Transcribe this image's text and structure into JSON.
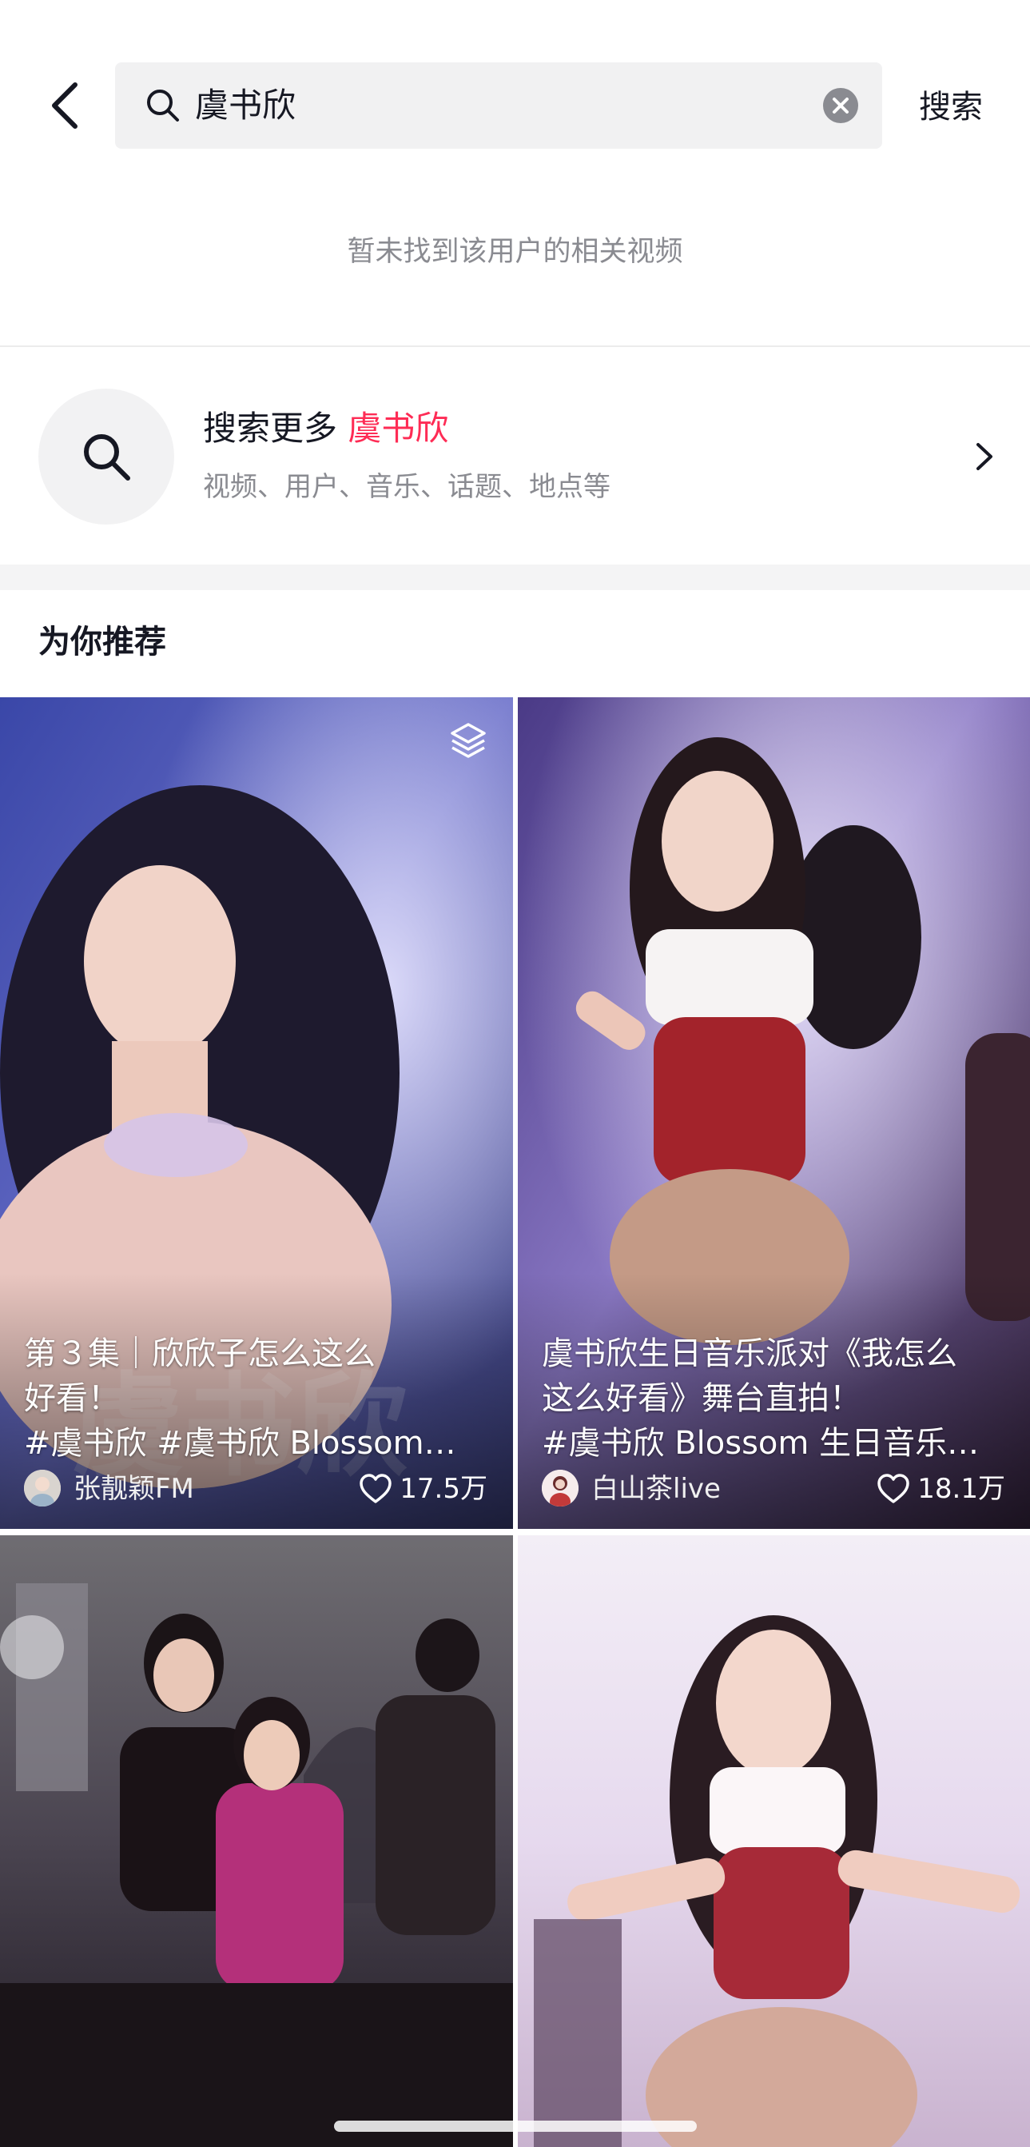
{
  "search": {
    "query": "虞书欣",
    "action_label": "搜索"
  },
  "empty_message": "暂未找到该用户的相关视频",
  "search_more": {
    "prefix": "搜索更多",
    "keyword": "虞书欣",
    "subtitle": "视频、用户、音乐、话题、地点等"
  },
  "recommend": {
    "title": "为你推荐",
    "cards": [
      {
        "title_line1": "第３集｜欣欣子怎么这么",
        "title_line2": "好看！",
        "title_line3": "#虞书欣 #虞书欣 Blossom…",
        "author": "张靓颖FM",
        "likes": "17.5万",
        "multi_icon": "layers-icon"
      },
      {
        "title_line1": "虞书欣生日音乐派对《我怎么",
        "title_line2": "这么好看》舞台直拍！",
        "title_line3": "#虞书欣 Blossom 生日音乐…",
        "author": "白山茶live",
        "likes": "18.1万"
      },
      {},
      {}
    ]
  },
  "colors": {
    "accent": "#fe2c55",
    "secondary_text": "#8a8b91",
    "search_bg": "#f1f1f2"
  }
}
